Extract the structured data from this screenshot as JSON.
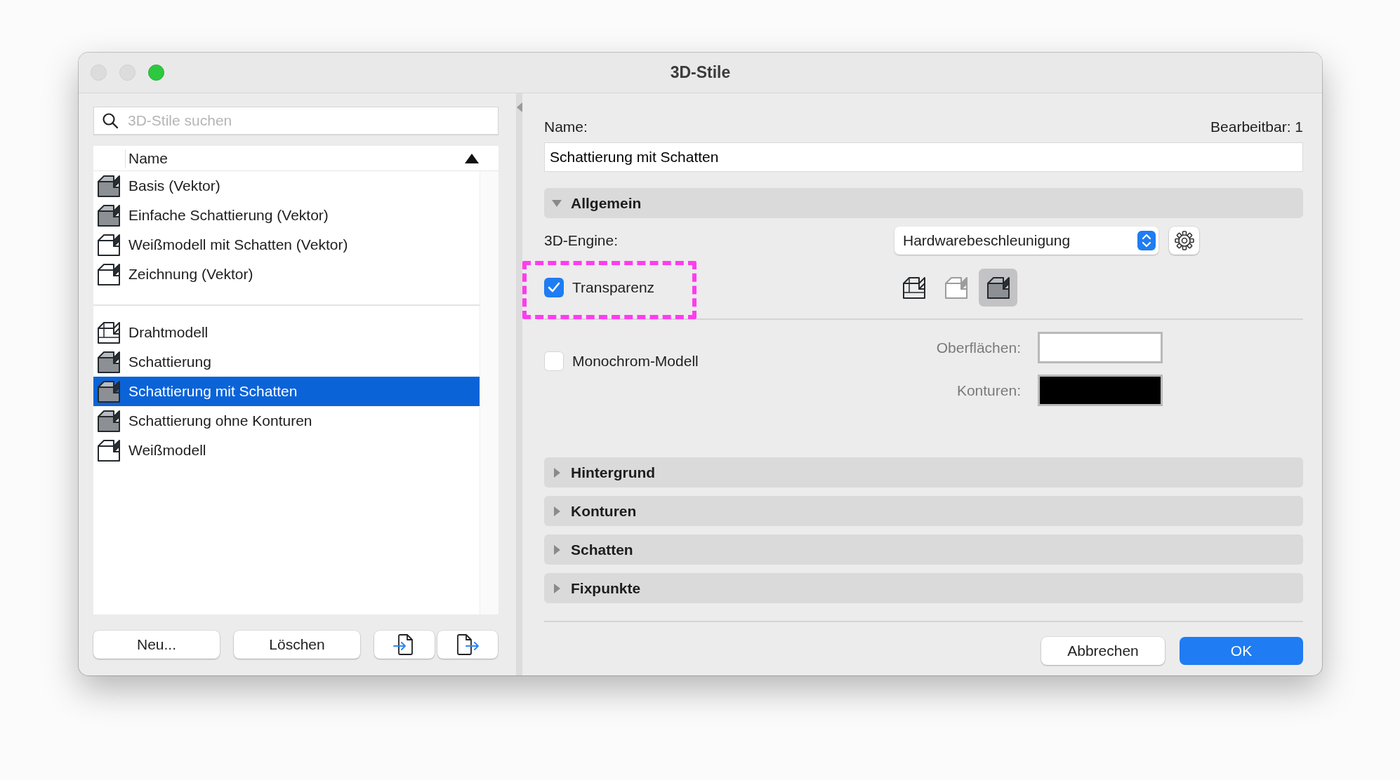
{
  "window": {
    "title": "3D-Stile"
  },
  "search": {
    "placeholder": "3D-Stile suchen"
  },
  "list": {
    "column": "Name",
    "groups": [
      {
        "items": [
          {
            "label": "Basis (Vektor)",
            "kind": "solid",
            "selected": false
          },
          {
            "label": "Einfache Schattierung (Vektor)",
            "kind": "solid",
            "selected": false
          },
          {
            "label": "Weißmodell mit Schatten (Vektor)",
            "kind": "white",
            "selected": false
          },
          {
            "label": "Zeichnung (Vektor)",
            "kind": "white",
            "selected": false
          }
        ]
      },
      {
        "items": [
          {
            "label": "Drahtmodell",
            "kind": "wire",
            "selected": false
          },
          {
            "label": "Schattierung",
            "kind": "solid",
            "selected": false
          },
          {
            "label": "Schattierung mit Schatten",
            "kind": "solid",
            "selected": true
          },
          {
            "label": "Schattierung ohne Konturen",
            "kind": "solid",
            "selected": false
          },
          {
            "label": "Weißmodell",
            "kind": "white",
            "selected": false
          }
        ]
      }
    ]
  },
  "left_buttons": [
    {
      "kind": "text",
      "label": "Neu..."
    },
    {
      "kind": "text",
      "label": "Löschen"
    },
    {
      "kind": "import"
    },
    {
      "kind": "export"
    }
  ],
  "name_label": "Name:",
  "editable": "Bearbeitbar: 1",
  "name_value": "Schattierung mit Schatten",
  "sections": [
    {
      "title": "Allgemein",
      "expanded": true
    },
    {
      "title": "Hintergrund",
      "expanded": false
    },
    {
      "title": "Konturen",
      "expanded": false
    },
    {
      "title": "Schatten",
      "expanded": false
    },
    {
      "title": "Fixpunkte",
      "expanded": false
    }
  ],
  "general": {
    "engine_label": "3D-Engine:",
    "engine_value": "Hardwarebeschleunigung",
    "transparency": {
      "label": "Transparenz",
      "checked": true,
      "highlighted": true
    },
    "modes": [
      {
        "kind": "wire",
        "selected": false,
        "disabled": false
      },
      {
        "kind": "white",
        "selected": false,
        "disabled": true
      },
      {
        "kind": "solid",
        "selected": true,
        "disabled": false
      }
    ],
    "monochrome": {
      "label": "Monochrom-Modell",
      "checked": false
    },
    "colors": [
      {
        "label": "Oberflächen:",
        "color": "#ffffff"
      },
      {
        "label": "Konturen:",
        "color": "#000000"
      }
    ]
  },
  "footer": [
    {
      "label": "Abbrechen",
      "primary": false
    },
    {
      "label": "OK",
      "primary": true
    }
  ]
}
